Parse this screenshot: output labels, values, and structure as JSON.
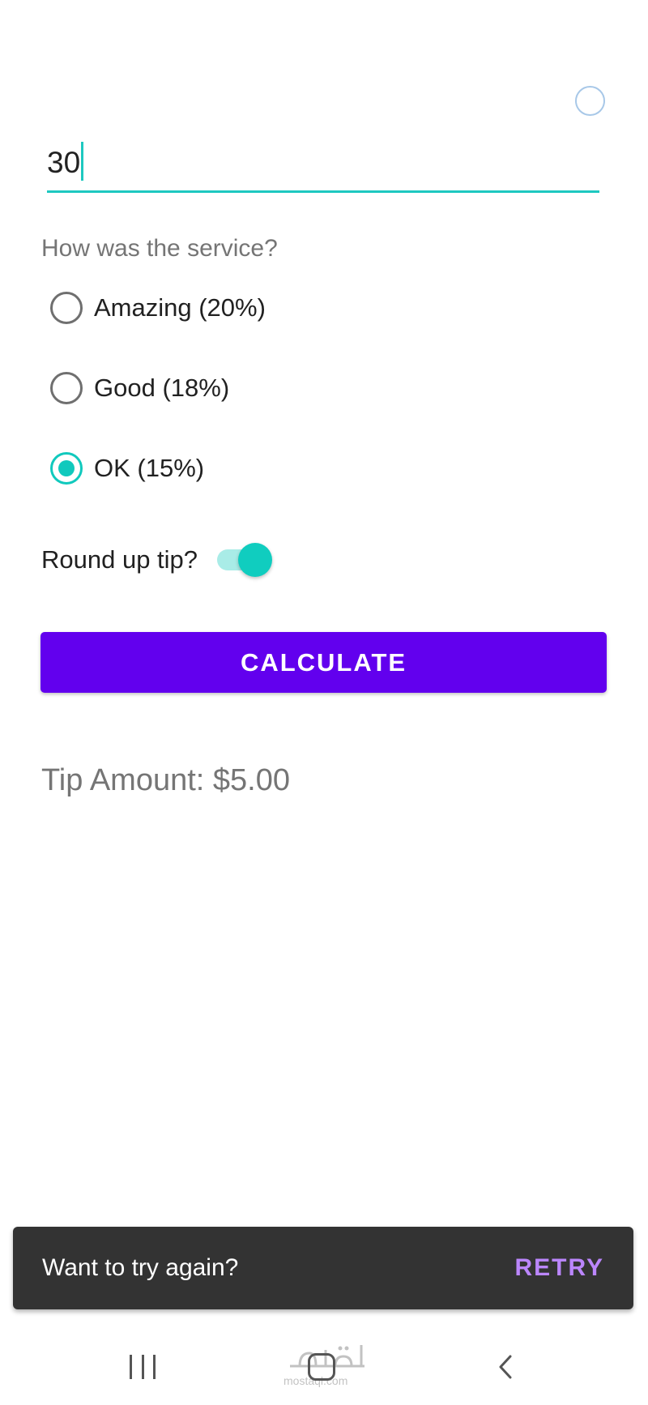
{
  "bill_input": {
    "value": "30"
  },
  "service": {
    "question": "How was the service?",
    "options": [
      {
        "label": "Amazing (20%)",
        "checked": false
      },
      {
        "label": "Good (18%)",
        "checked": false
      },
      {
        "label": "OK (15%)",
        "checked": true
      }
    ]
  },
  "round_up": {
    "label": "Round up tip?",
    "enabled": true
  },
  "calculate_button": {
    "label": "CALCULATE"
  },
  "result": {
    "tip_amount": "Tip Amount: $5.00"
  },
  "snackbar": {
    "message": "Want to try again?",
    "action": "RETRY"
  },
  "watermark": {
    "arabic": "مستقل",
    "latin": "mostaql.com"
  },
  "colors": {
    "accent": "#10c9bd",
    "primary": "#6200ee",
    "snackbar_bg": "#333333",
    "snackbar_action": "#bb86fc"
  }
}
